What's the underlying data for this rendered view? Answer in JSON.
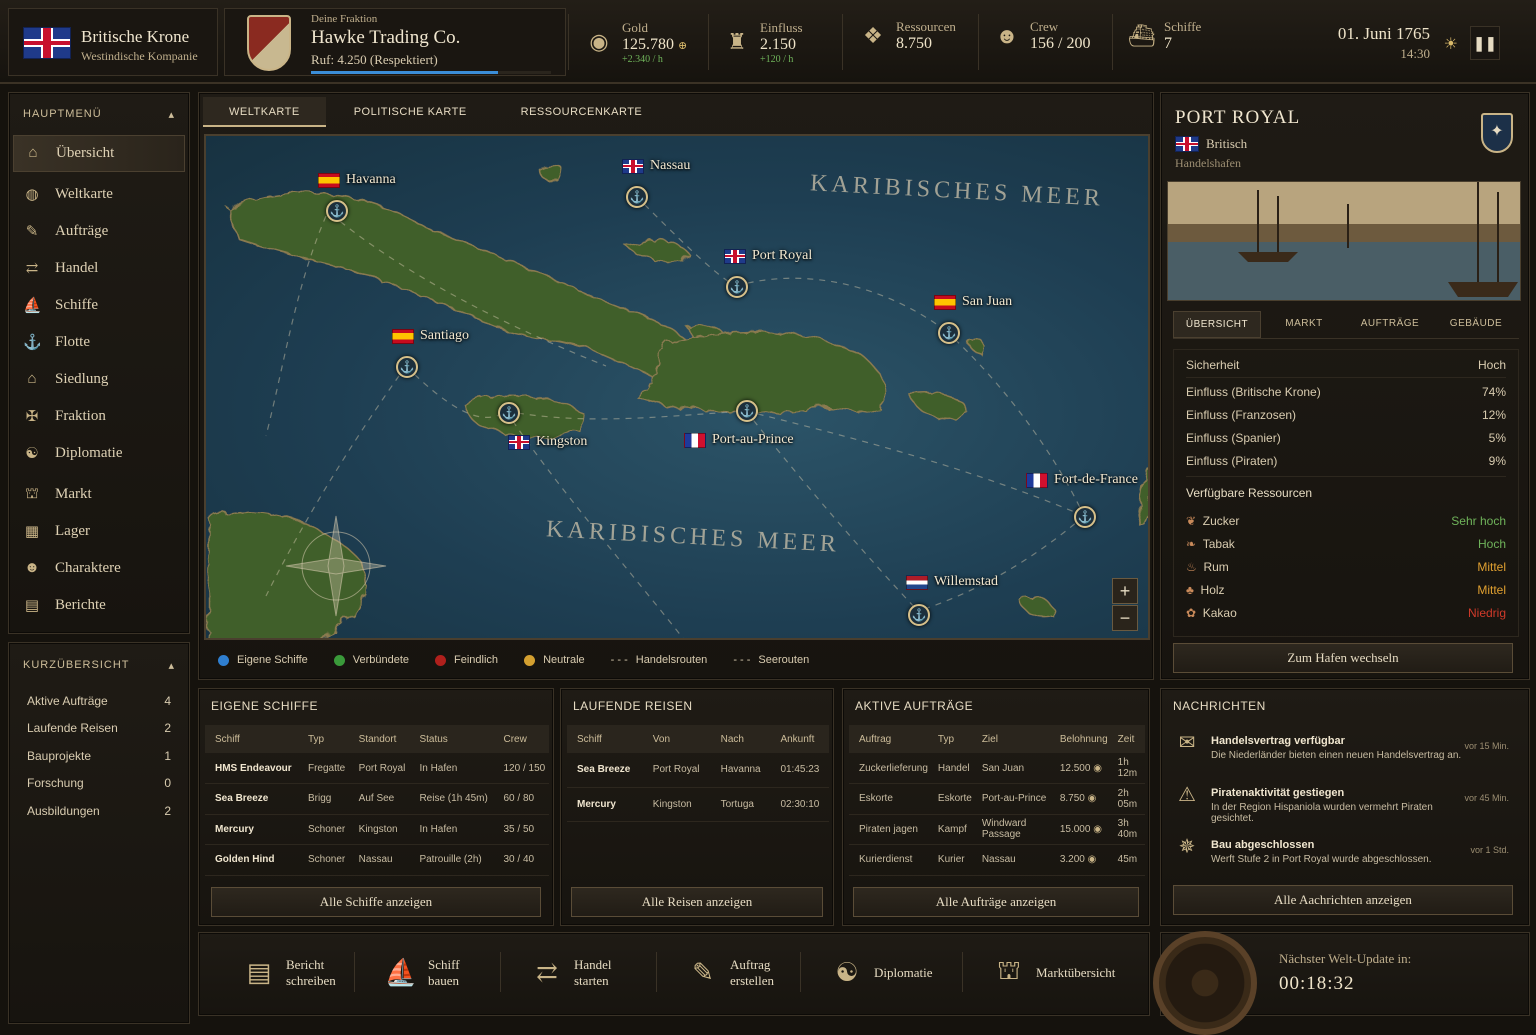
{
  "topbar": {
    "nation": "Britische Krone",
    "company": "Westindische Kompanie",
    "faction_label": "Deine Fraktion",
    "faction_name": "Hawke Trading Co.",
    "reputation": "Ruf: 4.250 (Respektiert)",
    "reputation_fraction": 0.78,
    "stats": [
      {
        "label": "Gold",
        "value": "125.780",
        "sub": "+2.340 / h",
        "icon": "coins-icon"
      },
      {
        "label": "Einfluss",
        "value": "2.150",
        "sub": "+120 / h",
        "icon": "influence-icon"
      },
      {
        "label": "Ressourcen",
        "value": "8.750",
        "sub": "",
        "icon": "resources-icon"
      },
      {
        "label": "Crew",
        "value": "156 / 200",
        "sub": "",
        "icon": "crew-icon"
      },
      {
        "label": "Schiffe",
        "value": "7",
        "sub": "",
        "icon": "ship-icon"
      }
    ],
    "date": "01. Juni 1765",
    "time": "14:30"
  },
  "sidebar": {
    "menu_title": "HAUPTMENÜ",
    "items": [
      {
        "label": "Übersicht",
        "icon": "home-icon"
      },
      {
        "label": "Weltkarte",
        "icon": "globe-icon"
      },
      {
        "label": "Aufträge",
        "icon": "quest-icon"
      },
      {
        "label": "Handel",
        "icon": "trade-icon"
      },
      {
        "label": "Schiffe",
        "icon": "ship-icon"
      },
      {
        "label": "Flotte",
        "icon": "fleet-icon"
      },
      {
        "label": "Siedlung",
        "icon": "settlement-icon"
      },
      {
        "label": "Fraktion",
        "icon": "faction-icon"
      },
      {
        "label": "Diplomatie",
        "icon": "diplomacy-icon"
      },
      {
        "label": "Markt",
        "icon": "market-icon"
      },
      {
        "label": "Lager",
        "icon": "storage-icon"
      },
      {
        "label": "Charaktere",
        "icon": "character-icon"
      },
      {
        "label": "Berichte",
        "icon": "report-icon"
      }
    ],
    "summary_title": "KURZÜBERSICHT",
    "summary": [
      {
        "label": "Aktive Aufträge",
        "value": "4"
      },
      {
        "label": "Laufende Reisen",
        "value": "2"
      },
      {
        "label": "Bauprojekte",
        "value": "1"
      },
      {
        "label": "Forschung",
        "value": "0"
      },
      {
        "label": "Ausbildungen",
        "value": "2"
      }
    ]
  },
  "map": {
    "tabs": [
      "WELTKARTE",
      "POLITISCHE KARTE",
      "RESSOURCENKARTE"
    ],
    "sea_label_1": "KARIBISCHES MEER",
    "sea_label_2": "KARIBISCHES MEER",
    "ports": [
      {
        "name": "Havanna",
        "flag": "es"
      },
      {
        "name": "Nassau",
        "flag": "uk"
      },
      {
        "name": "Port Royal",
        "flag": "uk"
      },
      {
        "name": "San Juan",
        "flag": "es"
      },
      {
        "name": "Santiago",
        "flag": "es"
      },
      {
        "name": "Kingston",
        "flag": "uk"
      },
      {
        "name": "Port-au-Prince",
        "flag": "fr"
      },
      {
        "name": "Fort-de-France",
        "flag": "fr"
      },
      {
        "name": "Willemstad",
        "flag": "nl"
      }
    ],
    "zoom_in": "+",
    "zoom_out": "−",
    "legend": [
      {
        "label": "Eigene Schiffe",
        "color": "#2f7fd0"
      },
      {
        "label": "Verbündete",
        "color": "#3a9a3a"
      },
      {
        "label": "Feindlich",
        "color": "#b0201c"
      },
      {
        "label": "Neutrale",
        "color": "#d4a030"
      },
      {
        "label": "Handelsrouten",
        "color": ""
      },
      {
        "label": "Seerouten",
        "color": ""
      }
    ]
  },
  "port_panel": {
    "name": "PORT ROYAL",
    "nation": "Britisch",
    "type": "Handelshafen",
    "tabs": [
      "ÜBERSICHT",
      "MARKT",
      "AUFTRÄGE",
      "GEBÄUDE"
    ],
    "security_label": "Sicherheit",
    "security_value": "Hoch",
    "influence": [
      {
        "label": "Einfluss (Britische Krone)",
        "value": "74%"
      },
      {
        "label": "Einfluss (Franzosen)",
        "value": "12%"
      },
      {
        "label": "Einfluss (Spanier)",
        "value": "5%"
      },
      {
        "label": "Einfluss (Piraten)",
        "value": "9%"
      }
    ],
    "resources_title": "Verfügbare Ressourcen",
    "resources": [
      {
        "label": "Zucker",
        "value": "Sehr hoch",
        "color": "#6fb35a"
      },
      {
        "label": "Tabak",
        "value": "Hoch",
        "color": "#6fb35a"
      },
      {
        "label": "Rum",
        "value": "Mittel",
        "color": "#e0a030"
      },
      {
        "label": "Holz",
        "value": "Mittel",
        "color": "#e0a030"
      },
      {
        "label": "Kakao",
        "value": "Niedrig",
        "color": "#d03a2a"
      }
    ],
    "switch_button": "Zum Hafen wechseln"
  },
  "ships": {
    "title": "EIGENE SCHIFFE",
    "headers": [
      "Schiff",
      "Typ",
      "Standort",
      "Status",
      "Crew"
    ],
    "rows": [
      [
        "HMS Endeavour",
        "Fregatte",
        "Port Royal",
        "In Hafen",
        "120 / 150"
      ],
      [
        "Sea Breeze",
        "Brigg",
        "Auf See",
        "Reise (1h 45m)",
        "60 / 80"
      ],
      [
        "Mercury",
        "Schoner",
        "Kingston",
        "In Hafen",
        "35 / 50"
      ],
      [
        "Golden Hind",
        "Schoner",
        "Nassau",
        "Patrouille (2h)",
        "30 / 40"
      ]
    ],
    "button": "Alle Schiffe anzeigen"
  },
  "voyages": {
    "title": "LAUFENDE REISEN",
    "headers": [
      "Schiff",
      "Von",
      "Nach",
      "Ankunft"
    ],
    "rows": [
      [
        "Sea Breeze",
        "Port Royal",
        "Havanna",
        "01:45:23"
      ],
      [
        "Mercury",
        "Kingston",
        "Tortuga",
        "02:30:10"
      ]
    ],
    "button": "Alle Reisen anzeigen"
  },
  "orders": {
    "title": "AKTIVE AUFTRÄGE",
    "headers": [
      "Auftrag",
      "Typ",
      "Ziel",
      "Belohnung",
      "Zeit"
    ],
    "rows": [
      [
        "Zuckerlieferung",
        "Handel",
        "San Juan",
        "12.500",
        "1h 12m"
      ],
      [
        "Eskorte",
        "Eskorte",
        "Port-au-Prince",
        "8.750",
        "2h 05m"
      ],
      [
        "Piraten jagen",
        "Kampf",
        "Windward Passage",
        "15.000",
        "3h 40m"
      ],
      [
        "Kurierdienst",
        "Kurier",
        "Nassau",
        "3.200",
        "45m"
      ]
    ],
    "button": "Alle Aufträge anzeigen"
  },
  "news": {
    "title": "NACHRICHTEN",
    "items": [
      {
        "title": "Handelsvertrag verfügbar",
        "text": "Die Niederländer bieten einen neuen Handelsvertrag an.",
        "time": "vor 15 Min.",
        "icon": "contract-icon"
      },
      {
        "title": "Piratenaktivität gestiegen",
        "text": "In der Region Hispaniola wurden vermehrt Piraten gesichtet.",
        "time": "vor 45 Min.",
        "icon": "warning-icon"
      },
      {
        "title": "Bau abgeschlossen",
        "text": "Werft Stufe 2 in Port Royal wurde abgeschlossen.",
        "time": "vor 1 Std.",
        "icon": "wheel-icon"
      }
    ],
    "button": "Alle Aachrichten anzeigen"
  },
  "actions": [
    {
      "l1": "Bericht",
      "l2": "schreiben",
      "icon": "report-icon"
    },
    {
      "l1": "Schiff",
      "l2": "bauen",
      "icon": "ship-icon"
    },
    {
      "l1": "Handel",
      "l2": "starten",
      "icon": "trade-icon"
    },
    {
      "l1": "Auftrag",
      "l2": "erstellen",
      "icon": "quest-icon"
    },
    {
      "l1": "Diplomatie",
      "l2": "",
      "icon": "diplomacy-icon"
    },
    {
      "l1": "Marktübersicht",
      "l2": "",
      "icon": "market-icon"
    }
  ],
  "update": {
    "label": "Nächster Welt-Update in:",
    "timer": "00:18:32"
  }
}
